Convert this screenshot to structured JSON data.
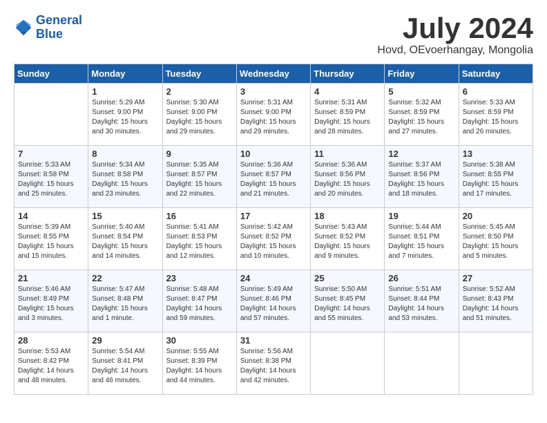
{
  "header": {
    "logo_line1": "General",
    "logo_line2": "Blue",
    "month_year": "July 2024",
    "location": "Hovd, OEvoerhangay, Mongolia"
  },
  "calendar": {
    "day_headers": [
      "Sunday",
      "Monday",
      "Tuesday",
      "Wednesday",
      "Thursday",
      "Friday",
      "Saturday"
    ],
    "weeks": [
      [
        {
          "day": "",
          "info": ""
        },
        {
          "day": "1",
          "info": "Sunrise: 5:29 AM\nSunset: 9:00 PM\nDaylight: 15 hours and 30 minutes."
        },
        {
          "day": "2",
          "info": "Sunrise: 5:30 AM\nSunset: 9:00 PM\nDaylight: 15 hours and 29 minutes."
        },
        {
          "day": "3",
          "info": "Sunrise: 5:31 AM\nSunset: 9:00 PM\nDaylight: 15 hours and 29 minutes."
        },
        {
          "day": "4",
          "info": "Sunrise: 5:31 AM\nSunset: 8:59 PM\nDaylight: 15 hours and 28 minutes."
        },
        {
          "day": "5",
          "info": "Sunrise: 5:32 AM\nSunset: 8:59 PM\nDaylight: 15 hours and 27 minutes."
        },
        {
          "day": "6",
          "info": "Sunrise: 5:33 AM\nSunset: 8:59 PM\nDaylight: 15 hours and 26 minutes."
        }
      ],
      [
        {
          "day": "7",
          "info": "Sunrise: 5:33 AM\nSunset: 8:58 PM\nDaylight: 15 hours and 25 minutes."
        },
        {
          "day": "8",
          "info": "Sunrise: 5:34 AM\nSunset: 8:58 PM\nDaylight: 15 hours and 23 minutes."
        },
        {
          "day": "9",
          "info": "Sunrise: 5:35 AM\nSunset: 8:57 PM\nDaylight: 15 hours and 22 minutes."
        },
        {
          "day": "10",
          "info": "Sunrise: 5:36 AM\nSunset: 8:57 PM\nDaylight: 15 hours and 21 minutes."
        },
        {
          "day": "11",
          "info": "Sunrise: 5:36 AM\nSunset: 8:56 PM\nDaylight: 15 hours and 20 minutes."
        },
        {
          "day": "12",
          "info": "Sunrise: 5:37 AM\nSunset: 8:56 PM\nDaylight: 15 hours and 18 minutes."
        },
        {
          "day": "13",
          "info": "Sunrise: 5:38 AM\nSunset: 8:55 PM\nDaylight: 15 hours and 17 minutes."
        }
      ],
      [
        {
          "day": "14",
          "info": "Sunrise: 5:39 AM\nSunset: 8:55 PM\nDaylight: 15 hours and 15 minutes."
        },
        {
          "day": "15",
          "info": "Sunrise: 5:40 AM\nSunset: 8:54 PM\nDaylight: 15 hours and 14 minutes."
        },
        {
          "day": "16",
          "info": "Sunrise: 5:41 AM\nSunset: 8:53 PM\nDaylight: 15 hours and 12 minutes."
        },
        {
          "day": "17",
          "info": "Sunrise: 5:42 AM\nSunset: 8:52 PM\nDaylight: 15 hours and 10 minutes."
        },
        {
          "day": "18",
          "info": "Sunrise: 5:43 AM\nSunset: 8:52 PM\nDaylight: 15 hours and 9 minutes."
        },
        {
          "day": "19",
          "info": "Sunrise: 5:44 AM\nSunset: 8:51 PM\nDaylight: 15 hours and 7 minutes."
        },
        {
          "day": "20",
          "info": "Sunrise: 5:45 AM\nSunset: 8:50 PM\nDaylight: 15 hours and 5 minutes."
        }
      ],
      [
        {
          "day": "21",
          "info": "Sunrise: 5:46 AM\nSunset: 8:49 PM\nDaylight: 15 hours and 3 minutes."
        },
        {
          "day": "22",
          "info": "Sunrise: 5:47 AM\nSunset: 8:48 PM\nDaylight: 15 hours and 1 minute."
        },
        {
          "day": "23",
          "info": "Sunrise: 5:48 AM\nSunset: 8:47 PM\nDaylight: 14 hours and 59 minutes."
        },
        {
          "day": "24",
          "info": "Sunrise: 5:49 AM\nSunset: 8:46 PM\nDaylight: 14 hours and 57 minutes."
        },
        {
          "day": "25",
          "info": "Sunrise: 5:50 AM\nSunset: 8:45 PM\nDaylight: 14 hours and 55 minutes."
        },
        {
          "day": "26",
          "info": "Sunrise: 5:51 AM\nSunset: 8:44 PM\nDaylight: 14 hours and 53 minutes."
        },
        {
          "day": "27",
          "info": "Sunrise: 5:52 AM\nSunset: 8:43 PM\nDaylight: 14 hours and 51 minutes."
        }
      ],
      [
        {
          "day": "28",
          "info": "Sunrise: 5:53 AM\nSunset: 8:42 PM\nDaylight: 14 hours and 48 minutes."
        },
        {
          "day": "29",
          "info": "Sunrise: 5:54 AM\nSunset: 8:41 PM\nDaylight: 14 hours and 46 minutes."
        },
        {
          "day": "30",
          "info": "Sunrise: 5:55 AM\nSunset: 8:39 PM\nDaylight: 14 hours and 44 minutes."
        },
        {
          "day": "31",
          "info": "Sunrise: 5:56 AM\nSunset: 8:38 PM\nDaylight: 14 hours and 42 minutes."
        },
        {
          "day": "",
          "info": ""
        },
        {
          "day": "",
          "info": ""
        },
        {
          "day": "",
          "info": ""
        }
      ]
    ]
  }
}
